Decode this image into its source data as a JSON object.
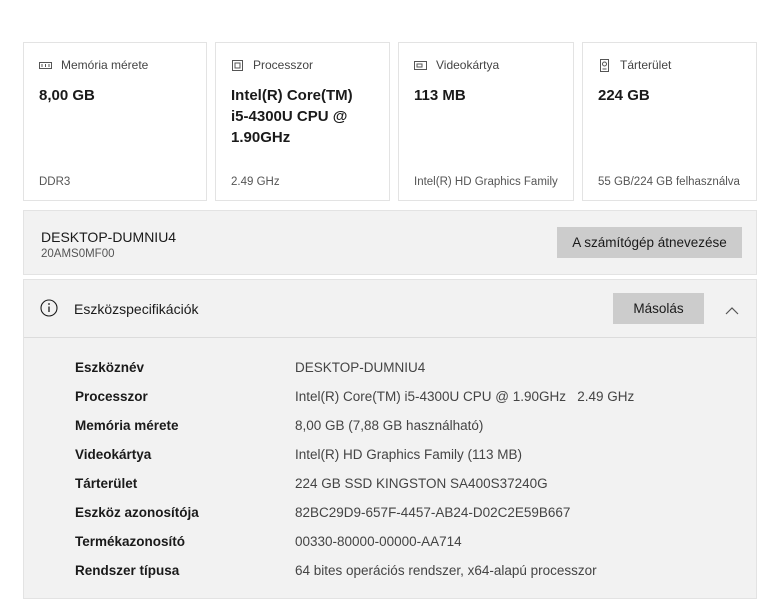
{
  "cards": [
    {
      "icon": "memory-icon",
      "label": "Memória mérete",
      "value": "8,00 GB",
      "footer": "DDR3"
    },
    {
      "icon": "processor-icon",
      "label": "Processzor",
      "value": "Intel(R) Core(TM)\ni5-4300U CPU @\n1.90GHz",
      "footer": "2.49 GHz"
    },
    {
      "icon": "graphics-card-icon",
      "label": "Videokártya",
      "value": "113 MB",
      "footer": "Intel(R) HD Graphics Family"
    },
    {
      "icon": "storage-icon",
      "label": "Tárterület",
      "value": "224 GB",
      "footer": "55 GB/224 GB felhasználva"
    }
  ],
  "device": {
    "name": "DESKTOP-DUMNIU4",
    "model": "20AMS0MF00",
    "rename_label": "A számítógép átnevezése"
  },
  "specs": {
    "title": "Eszközspecifikációk",
    "copy_label": "Másolás",
    "rows": [
      {
        "key": "Eszköznév",
        "value": "DESKTOP-DUMNIU4"
      },
      {
        "key": "Processzor",
        "value": "Intel(R) Core(TM) i5-4300U CPU @ 1.90GHz   2.49 GHz"
      },
      {
        "key": "Memória mérete",
        "value": "8,00 GB (7,88 GB használható)"
      },
      {
        "key": "Videokártya",
        "value": "Intel(R) HD Graphics Family (113 MB)"
      },
      {
        "key": "Tárterület",
        "value": "224 GB SSD KINGSTON SA400S37240G"
      },
      {
        "key": "Eszköz azonosítója",
        "value": "82BC29D9-657F-4457-AB24-D02C2E59B667"
      },
      {
        "key": "Termékazonosító",
        "value": "00330-80000-00000-AA714"
      },
      {
        "key": "Rendszer típusa",
        "value": "64 bites operációs rendszer, x64-alapú processzor"
      }
    ]
  }
}
